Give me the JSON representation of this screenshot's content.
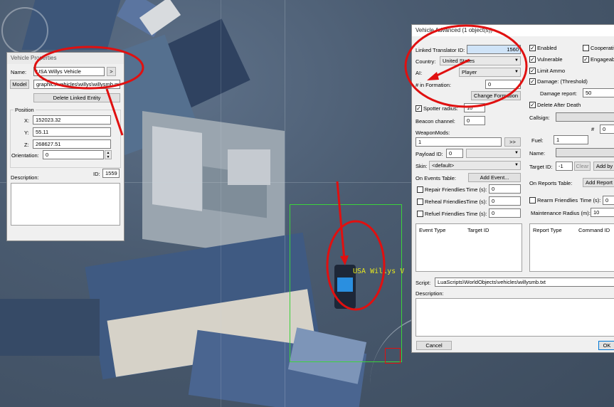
{
  "map": {
    "vehicle_label": "USA Willys V"
  },
  "vehicle_properties": {
    "title": "Vehicle Properties",
    "name_label": "Name:",
    "name_value": "USA Willys Vehicle",
    "name_button": ">",
    "model_button": "Model",
    "model_value": "graphics\\vehicles\\willys\\willysmb.me",
    "delete_linked_button": "Delete Linked Entity",
    "position_label": "Position",
    "x_label": "X:",
    "x_value": "152023.32",
    "y_label": "Y:",
    "y_value": "55.11",
    "z_label": "Z:",
    "z_value": "268627.51",
    "orientation_label": "Orientation:",
    "orientation_value": "0",
    "description_label": "Description:",
    "id_label": "ID:",
    "id_value": "1559"
  },
  "vehicle_advanced": {
    "title": "Vehicle Advanced (1 object(s))",
    "linked_translator_label": "Linked Translator ID:",
    "linked_translator_value": "1560",
    "country_label": "Country:",
    "country_value": "United States",
    "ai_label": "AI:",
    "ai_value": "Player",
    "formation_label": "# in Formation:",
    "formation_value": "0",
    "change_formation_button": "Change Formation",
    "spotter_radius_label": "Spotter radius:",
    "spotter_radius_value": "10",
    "beacon_channel_label": "Beacon channel:",
    "beacon_channel_value": "0",
    "weapon_mods_label": "WeaponMods:",
    "weapon_mods_value": "1",
    "weapon_mods_button": ">>",
    "payload_id_label": "Payload ID:",
    "payload_id_value": "0",
    "skin_label": "Skin:",
    "skin_value": "<default>",
    "on_events_label": "On Events Table:",
    "add_event_button": "Add Event...",
    "repair_friendlies_label": "Repair Friendlies",
    "reheal_friendlies_label": "Reheal Friendlies",
    "refuel_friendlies_label": "Refuel Friendlies",
    "time_label": "Time (s):",
    "repair_time": "0",
    "reheal_time": "0",
    "refuel_time": "0",
    "events_columns": [
      "Event Type",
      "Target ID"
    ],
    "enabled_label": "Enabled",
    "cooperative_label": "Cooperative",
    "vulnerable_label": "Vulnerable",
    "engageable_label": "Engageable",
    "limit_ammo_label": "Limit Ammo",
    "damage_label": "Damage: (Threshold)",
    "damage_report_label": "Damage report:",
    "damage_report_value": "50",
    "delete_after_death_label": "Delete After Death",
    "callsign_label": "Callsign:",
    "hash_label": "#",
    "hash_value": "0",
    "fuel_label": "Fuel:",
    "fuel_value": "1",
    "name_label": "Name:",
    "target_id_label": "Target ID:",
    "target_id_value": "-1",
    "clear_button": "Clear",
    "add_by_button": "Add by",
    "on_reports_label": "On Reports Table:",
    "add_report_button": "Add Report",
    "rearm_friendlies_label": "Rearm Friendlies",
    "rearm_time": "0",
    "maintenance_radius_label": "Maintenance Radius (m):",
    "maintenance_radius_value": "10",
    "reports_columns": [
      "Report Type",
      "Command ID"
    ],
    "script_label": "Script:",
    "script_value": "LuaScripts\\WorldObjects\\vehicles\\willysmb.txt",
    "description_label": "Description:",
    "cancel_button": "Cancel",
    "ok_button": "OK"
  },
  "colors": {
    "annotation": "#e01010",
    "selection": "#3cd23c",
    "vehicle_label": "#e6e61e"
  }
}
